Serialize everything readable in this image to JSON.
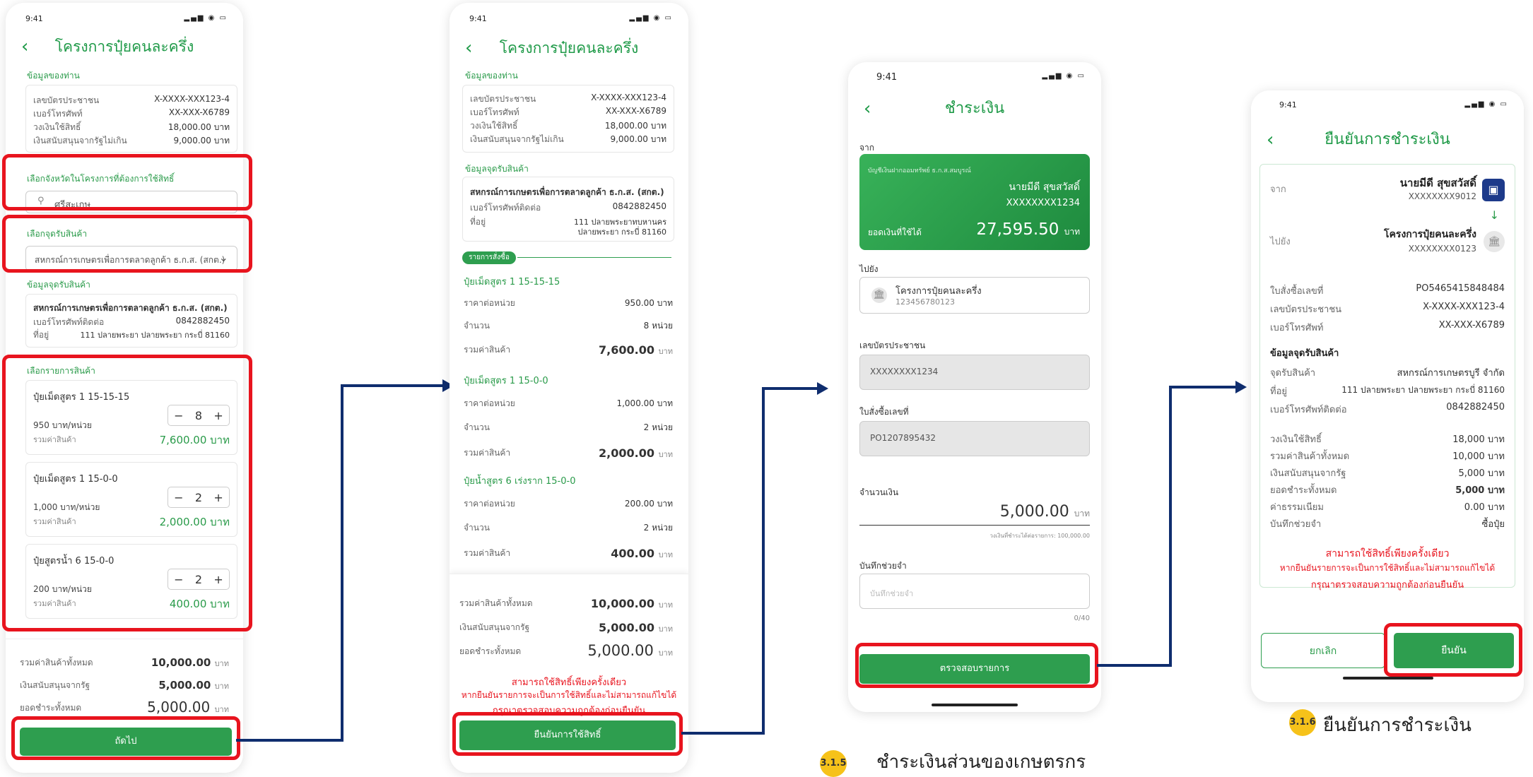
{
  "status_time": "9:41",
  "phone1": {
    "title": "โครงการปุ๋ยคนละครึ่ง",
    "sec_info": "ข้อมูลของท่าน",
    "info": [
      {
        "label": "เลขบัตรประชาชน",
        "value": "X-XXXX-XXX123-4"
      },
      {
        "label": "เบอร์โทรศัพท์",
        "value": "XX-XXX-X6789"
      },
      {
        "label": "วงเงินใช้สิทธิ์",
        "value": "18,000.00 บาท"
      },
      {
        "label": "เงินสนับสนุนจากรัฐไม่เกิน",
        "value": "9,000.00 บาท"
      }
    ],
    "sec_province": "เลือกจังหวัดในโครงการที่ต้องการใช้สิทธิ์",
    "province_value": "ศรีสะเกษ",
    "sec_point": "เลือกจุดรับสินค้า",
    "point_value": "สหกรณ์การเกษตรเพื่อการตลาดลูกค้า ธ.ก.ส. (สกต.)",
    "sec_point_info": "ข้อมูลจุดรับสินค้า",
    "point_name": "สหกรณ์การเกษตรเพื่อการตลาดลูกค้า ธ.ก.ส. (สกต.)",
    "point_phone_label": "เบอร์โทรศัพท์ติดต่อ",
    "point_phone": "0842882450",
    "point_addr_label": "ที่อยู่",
    "point_addr": "111 ปลายพระยา ปลายพระยา กระบี่ 81160",
    "sec_items": "เลือกรายการสินค้า",
    "items": [
      {
        "name": "ปุ๋ยเม็ดสูตร 1 15-15-15",
        "price": "950 บาท/หน่วย",
        "qty": "8",
        "sum_label": "รวมค่าสินค้า",
        "sum": "7,600.00 บาท"
      },
      {
        "name": "ปุ๋ยเม็ดสูตร 1 15-0-0",
        "price": "1,000 บาท/หน่วย",
        "qty": "2",
        "sum_label": "รวมค่าสินค้า",
        "sum": "2,000.00 บาท"
      },
      {
        "name": "ปุ๋ยสูตรน้ำ 6 15-0-0",
        "price": "200 บาท/หน่วย",
        "qty": "2",
        "sum_label": "รวมค่าสินค้า",
        "sum": "400.00 บาท"
      }
    ],
    "total_label": "รวมค่าสินค้าทั้งหมด",
    "total": "10,000.00",
    "subsidy_label": "เงินสนับสนุนจากรัฐ",
    "subsidy": "5,000.00",
    "pay_label": "ยอดชำระทั้งหมด",
    "pay": "5,000.00",
    "unit": "บาท",
    "next_button": "ถัดไป"
  },
  "phone2": {
    "title": "โครงการปุ๋ยคนละครึ่ง",
    "sec_info": "ข้อมูลของท่าน",
    "info": [
      {
        "label": "เลขบัตรประชาชน",
        "value": "X-XXXX-XXX123-4"
      },
      {
        "label": "เบอร์โทรศัพท์",
        "value": "XX-XXX-X6789"
      },
      {
        "label": "วงเงินใช้สิทธิ์",
        "value": "18,000.00 บาท"
      },
      {
        "label": "เงินสนับสนุนจากรัฐไม่เกิน",
        "value": "9,000.00 บาท"
      }
    ],
    "sec_point_info": "ข้อมูลจุดรับสินค้า",
    "point_name": "สหกรณ์การเกษตรเพื่อการตลาดลูกค้า ธ.ก.ส. (สกต.)",
    "point_phone_label": "เบอร์โทรศัพท์ติดต่อ",
    "point_phone": "0842882450",
    "point_addr_label": "ที่อยู่",
    "point_addr1": "111 ปลายพระยาทบหานคร",
    "point_addr2": "ปลายพระยา กระบี่ 81160",
    "order_tag": "รายการสั่งซื้อ",
    "groups": [
      {
        "name": "ปุ๋ยเม็ดสูตร 1 15-15-15",
        "rows": [
          {
            "l": "ราคาต่อหน่วย",
            "v": "950.00 บาท"
          },
          {
            "l": "จำนวน",
            "v": "8 หน่วย"
          }
        ],
        "sum_label": "รวมค่าสินค้า",
        "sum": "7,600.00",
        "unit": "บาท"
      },
      {
        "name": "ปุ๋ยเม็ดสูตร 1 15-0-0",
        "rows": [
          {
            "l": "ราคาต่อหน่วย",
            "v": "1,000.00 บาท"
          },
          {
            "l": "จำนวน",
            "v": "2 หน่วย"
          }
        ],
        "sum_label": "รวมค่าสินค้า",
        "sum": "2,000.00",
        "unit": "บาท"
      },
      {
        "name": "ปุ๋ยน้ำสูตร 6 เร่งราก 15-0-0",
        "rows": [
          {
            "l": "ราคาต่อหน่วย",
            "v": "200.00 บาท"
          },
          {
            "l": "จำนวน",
            "v": "2 หน่วย"
          }
        ],
        "sum_label": "รวมค่าสินค้า",
        "sum": "400.00",
        "unit": "บาท"
      }
    ],
    "total_label": "รวมค่าสินค้าทั้งหมด",
    "total": "10,000.00",
    "subsidy_label": "เงินสนับสนุนจากรัฐ",
    "subsidy": "5,000.00",
    "pay_label": "ยอดชำระทั้งหมด",
    "pay": "5,000.00",
    "unit": "บาท",
    "warn1": "สามารถใช้สิทธิ์เพียงครั้งเดียว",
    "warn2": "หากยืนยันรายการจะเป็นการใช้สิทธิ์และไม่สามารถแก้ไขได้",
    "warn3": "กรุณาตรวจสอบความถูกต้องก่อนยืนยัน",
    "confirm_button": "ยืนยันการใช้สิทธิ์"
  },
  "phone3": {
    "title": "ชำระเงิน",
    "from_label": "จาก",
    "account_type": "บัญชีเงินฝากออมทรัพย์ ธ.ก.ส.สมบูรณ์",
    "account_name": "นายมีดี สุขสวัสดิ์",
    "account_no": "XXXXXXXX1234",
    "balance_label": "ยอดเงินที่ใช้ได้",
    "balance": "27,595.50",
    "unit": "บาท",
    "to_label": "ไปยัง",
    "to_name": "โครงการปุ๋ยคนละครึ่ง",
    "to_no": "123456780123",
    "id_label": "เลขบัตรประชาชน",
    "id_value": "XXXXXXXX1234",
    "po_label": "ใบสั่งซื้อเลขที่",
    "po_value": "PO1207895432",
    "amount_label": "จำนวนเงิน",
    "amount": "5,000.00",
    "limit_text": "วงเงินที่ชำระได้ต่อรายการ: 100,000.00",
    "memo_label": "บันทึกช่วยจำ",
    "memo_placeholder": "บันทึกช่วยจำ",
    "memo_count": "0/40",
    "check_button": "ตรวจสอบรายการ"
  },
  "phone4": {
    "title": "ยืนยันการชำระเงิน",
    "from_label": "จาก",
    "from_name": "นายมีดี สุขสวัสดิ์",
    "from_no": "XXXXXXXX9012",
    "to_label": "ไปยัง",
    "to_name": "โครงการปุ๋ยคนละครึ่ง",
    "to_no": "XXXXXXXX0123",
    "rows1": [
      {
        "l": "ใบสั่งซื้อเลขที่",
        "v": "PO5465415848484"
      },
      {
        "l": "เลขบัตรประชาชน",
        "v": "X-XXXX-XXX123-4"
      },
      {
        "l": "เบอร์โทรศัพท์",
        "v": "XX-XXX-X6789"
      }
    ],
    "sec_point": "ข้อมูลจุดรับสินค้า",
    "rows2": [
      {
        "l": "จุดรับสินค้า",
        "v": "สหกรณ์การเกษตรบูรี จำกัด"
      },
      {
        "l": "ที่อยู่",
        "v": "111 ปลายพระยา ปลายพระยา กระบี่ 81160"
      },
      {
        "l": "เบอร์โทรศัพท์ติดต่อ",
        "v": "0842882450"
      }
    ],
    "rows3": [
      {
        "l": "วงเงินใช้สิทธิ์",
        "v": "18,000 บาท"
      },
      {
        "l": "รวมค่าสินค้าทั้งหมด",
        "v": "10,000 บาท"
      },
      {
        "l": "เงินสนับสนุนจากรัฐ",
        "v": "5,000 บาท"
      },
      {
        "l": "ยอดชำระทั้งหมด",
        "v": "5,000 บาท"
      },
      {
        "l": "ค่าธรรมเนียม",
        "v": "0.00 บาท"
      },
      {
        "l": "บันทึกช่วยจำ",
        "v": "ซื้อปุ๋ย"
      }
    ],
    "warn1": "สามารถใช้สิทธิ์เพียงครั้งเดียว",
    "warn2": "หากยืนยันรายการจะเป็นการใช้สิทธิ์และไม่สามารถแก้ไขได้",
    "warn3": "กรุณาตรวจสอบความถูกต้องก่อนยืนยัน",
    "cancel_button": "ยกเลิก",
    "confirm_button": "ยืนยัน"
  },
  "caption5": {
    "num": "3.1.5",
    "text": "ชำระเงินส่วนของเกษตรกร"
  },
  "caption6": {
    "num": "3.1.6",
    "text": "ยืนยันการชำระเงิน"
  },
  "colors": {
    "green": "#2e9e4f",
    "red": "#e8141e",
    "arrow": "#0f2d6e",
    "badge": "#f6c21a"
  }
}
